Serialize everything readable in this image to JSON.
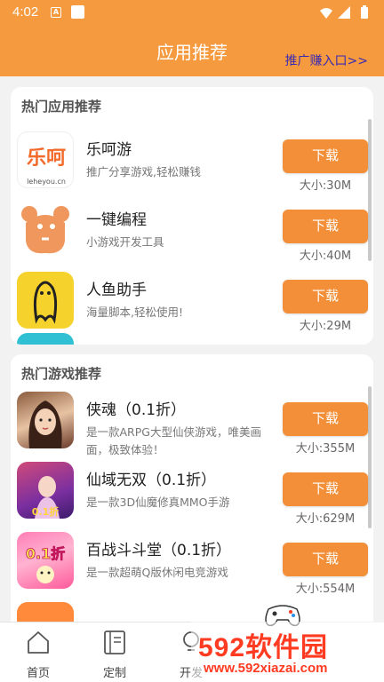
{
  "status_bar": {
    "time": "4:02",
    "notif_letter": "A"
  },
  "header": {
    "title": "应用推荐",
    "promo_link": "推广赚入口>>"
  },
  "hot_apps": {
    "title": "热门应用推荐",
    "items": [
      {
        "name": "乐呵游",
        "desc": "推广分享游戏,轻松赚钱",
        "button": "下载",
        "size": "大小:30M",
        "icon_text": "乐呵",
        "icon_sub": "leheyou.cn"
      },
      {
        "name": "一键编程",
        "desc": "小游戏开发工具",
        "button": "下载",
        "size": "大小:40M"
      },
      {
        "name": "人鱼助手",
        "desc": "海量脚本,轻松使用!",
        "button": "下载",
        "size": "大小:29M"
      },
      {
        "name": "",
        "desc": "",
        "button": "",
        "size": ""
      }
    ]
  },
  "hot_games": {
    "title": "热门游戏推荐",
    "items": [
      {
        "name": "侠魂（0.1折）",
        "desc": "是一款ARPG大型仙侠游戏，唯美画面，极致体验！",
        "button": "下载",
        "size": "大小:355M"
      },
      {
        "name": "仙域无双（0.1折）",
        "desc": "是一款3D仙魔修真MMO手游",
        "button": "下载",
        "size": "大小:629M",
        "icon_badge": "0.1折"
      },
      {
        "name": "百战斗斗堂（0.1折）",
        "desc": "是一款超萌Q版休闲电竞游戏",
        "button": "下载",
        "size": "大小:554M",
        "icon_badge": "0.1折"
      },
      {
        "name": "",
        "desc": "",
        "button": "",
        "size": ""
      }
    ]
  },
  "bottom_nav": [
    {
      "label": "首页",
      "icon": "home-icon"
    },
    {
      "label": "定制",
      "icon": "book-icon"
    },
    {
      "label": "开发",
      "icon": "bulb-icon"
    }
  ],
  "watermark": {
    "main": "592软件园",
    "url": "www.592xiazai.com"
  },
  "colors": {
    "primary": "#f59a3e",
    "button": "#f38f38",
    "promo": "#3b2bb3",
    "watermark": "#ff3b22"
  }
}
